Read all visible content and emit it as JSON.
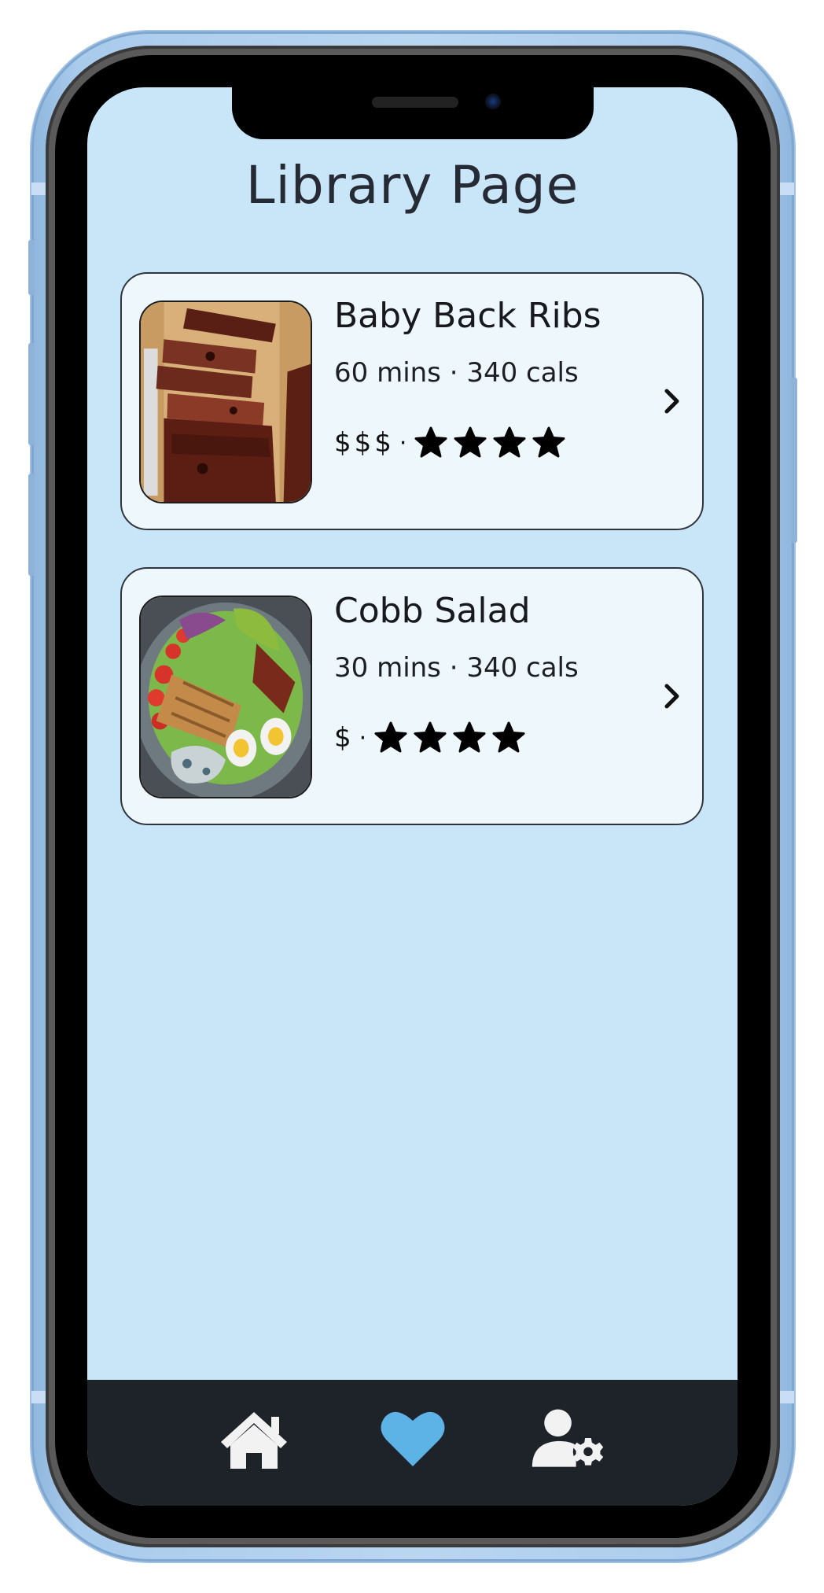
{
  "page": {
    "title": "Library Page"
  },
  "recipes": [
    {
      "name": "Baby Back Ribs",
      "meta": "60 mins · 340 cals",
      "price": "$$$",
      "rating": 4,
      "image": "ribs-photo"
    },
    {
      "name": "Cobb Salad",
      "meta": "30 mins · 340 cals",
      "price": "$",
      "rating": 4,
      "image": "salad-photo"
    }
  ],
  "price_rating_separator": "·",
  "nav": {
    "items": [
      {
        "icon": "home-icon",
        "active": false
      },
      {
        "icon": "heart-icon",
        "active": true
      },
      {
        "icon": "user-settings-icon",
        "active": false
      }
    ]
  },
  "colors": {
    "screen_bg": "#c8e6f7",
    "card_bg": "#eef7fc",
    "nav_bg": "#1e2329",
    "nav_active": "#5db3e6",
    "nav_inactive": "#f2f2f2"
  }
}
